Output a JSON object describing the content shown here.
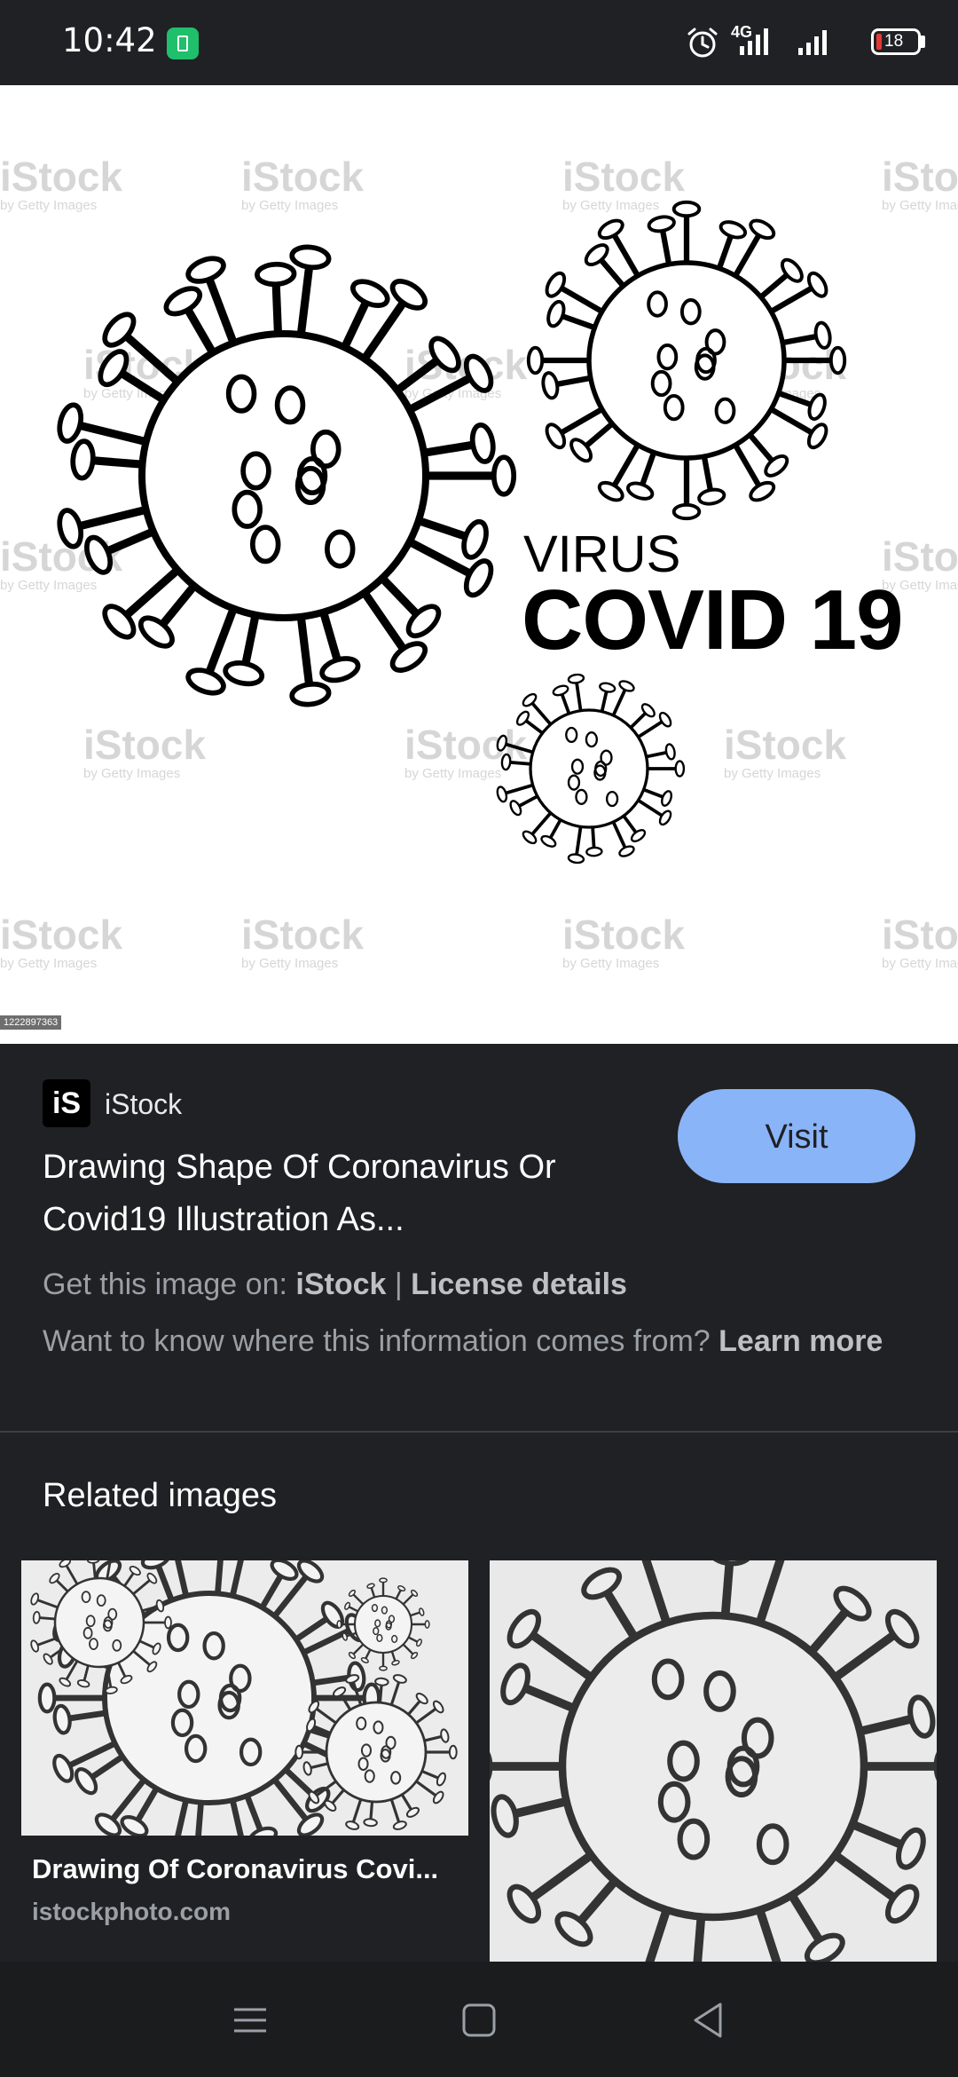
{
  "status_bar": {
    "time": "10:42",
    "network_type": "4G",
    "battery_level": "18",
    "icons": [
      "battery-saver-icon",
      "alarm-icon",
      "signal-icon",
      "signal-icon",
      "battery-icon"
    ]
  },
  "image": {
    "headline_small": "VIRUS",
    "headline_large": "COVID 19",
    "watermark": "iStock",
    "watermark_sub": "by Getty Images",
    "image_id": "1222897363"
  },
  "result": {
    "source_logo": "iS",
    "source_name": "iStock",
    "visit_label": "Visit",
    "title": "Drawing Shape Of Coronavirus Or Covid19 Illustration As...",
    "get_image_prefix": "Get this image on: ",
    "get_image_site": "iStock",
    "separator": "|",
    "license_label": "License details",
    "info_question": "Want to know where this information comes from? ",
    "learn_more": "Learn more"
  },
  "related": {
    "heading": "Related images",
    "cards": [
      {
        "title": "Drawing Of Coronavirus Covi...",
        "source": "istockphoto.com"
      },
      {
        "title": "",
        "source": ""
      }
    ]
  },
  "nav_bar": {
    "buttons": [
      "menu-icon",
      "home-icon",
      "back-icon"
    ]
  },
  "colors": {
    "background": "#202124",
    "visit_button": "#8ab4f8",
    "battery_low": "#e53935",
    "battery_saver": "#1fbf6b"
  }
}
